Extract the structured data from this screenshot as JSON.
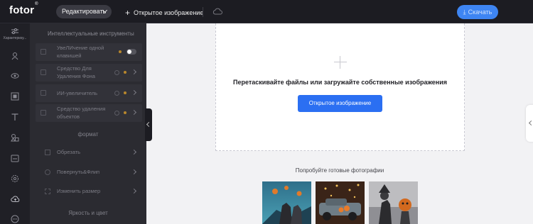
{
  "topbar": {
    "logo": "fotor",
    "logo_mark": "®",
    "edit_label": "Редактировать",
    "open_label": "Открытое изображение",
    "download_label": "Скачать"
  },
  "rail": {
    "adjust_label": "Характеризу..."
  },
  "panel": {
    "smart_title": "Интеллектуальные инструменты",
    "tools": [
      {
        "label": "УвеЛИчение одной клавишей"
      },
      {
        "label": "Средство Для Удаления Фона"
      },
      {
        "label": "ИИ-увеличитель"
      },
      {
        "label": "Средство удаления объектов"
      }
    ],
    "format_title": "формат",
    "format_items": [
      {
        "label": "Обрезать"
      },
      {
        "label": "Повернуть&Флип"
      },
      {
        "label": "Изменить размер"
      }
    ],
    "brightness_title": "Яркость и цвет"
  },
  "canvas": {
    "drop_text": "Перетаскивайте файлы или загружайте собственные изображения",
    "open_button": "Открытое изображение",
    "try_text": "Попробуйте готовые фотографии"
  },
  "colors": {
    "accent": "#2b6ff2",
    "download": "#3e85f2",
    "dot": "#b7862c"
  }
}
